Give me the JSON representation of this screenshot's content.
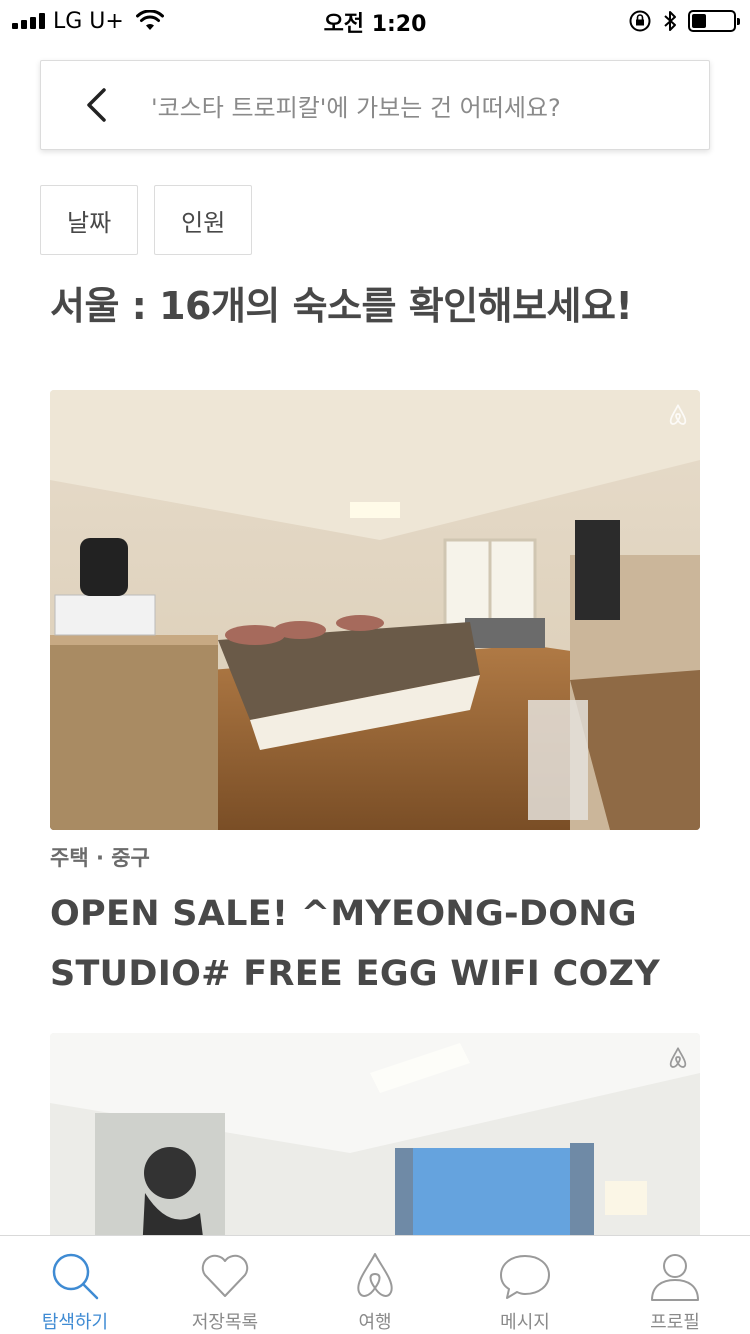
{
  "status_bar": {
    "carrier": "LG U+",
    "time": "오전 1:20",
    "battery_level": 0.35
  },
  "search": {
    "placeholder": "'코스타 트로피칼'에 가보는 건 어떠세요?",
    "back_icon": "chevron-left-icon"
  },
  "filters": [
    {
      "label": "날짜"
    },
    {
      "label": "인원"
    }
  ],
  "page_title": "서울 : 16개의 숙소를 확인해보세요!",
  "listings": [
    {
      "meta": "주택 · 중구",
      "title_line1": "OPEN SALE! ^MYEONG-DONG",
      "title_line2": "STUDIO# FREE EGG WIFI COZY",
      "badge_icon": "airbnb-logo-icon"
    },
    {
      "badge_icon": "airbnb-logo-icon"
    }
  ],
  "tab_bar": {
    "items": [
      {
        "label": "탐색하기",
        "icon": "search-icon",
        "active": true
      },
      {
        "label": "저장목록",
        "icon": "heart-icon",
        "active": false
      },
      {
        "label": "여행",
        "icon": "airbnb-logo-icon",
        "active": false
      },
      {
        "label": "메시지",
        "icon": "chat-bubble-icon",
        "active": false
      },
      {
        "label": "프로필",
        "icon": "profile-icon",
        "active": false
      }
    ]
  },
  "colors": {
    "accent": "#3f8bd3",
    "text": "#484848",
    "muted": "#8a8a8a"
  }
}
